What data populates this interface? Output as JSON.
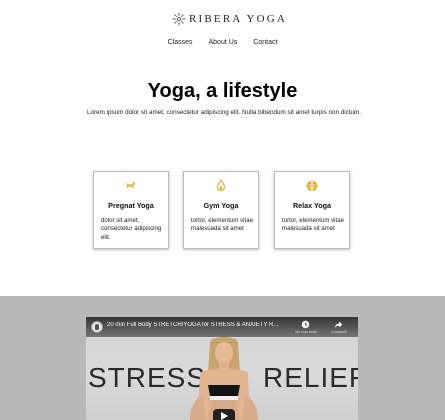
{
  "brand": {
    "name": "RIBERA YOGA",
    "logo_icon": "sun-mandala-icon"
  },
  "nav": {
    "items": [
      "Classes",
      "About Us",
      "Contact"
    ]
  },
  "hero": {
    "title": "Yoga, a lifestyle",
    "text": "Lorem ipsum dolor sit amet, consectetur adipiscing elit. Nulla bibendum sit amet turpis non dictum."
  },
  "cards": [
    {
      "icon": "dog-icon",
      "title": "Pregnat Yoga",
      "text": "dolor sit amet, consectetur adipiscing elit."
    },
    {
      "icon": "flame-icon",
      "title": "Gym Yoga",
      "text": "tortor, elementum vitae malesuada sit amet"
    },
    {
      "icon": "brain-icon",
      "title": "Relax Yoga",
      "text": "tortor, elementum vitae malesuada sit amet"
    }
  ],
  "video": {
    "title": "20 min Full Body STRETCH/YOGA for STRESS & ANXIETY R...",
    "watch_later": "Ver más tarde",
    "share": "Compartir",
    "overlay_left": "STRESS",
    "overlay_right": "RELIEF"
  },
  "colors": {
    "accent": "#e3b53c",
    "video_section_bg": "#b8b8b8"
  }
}
